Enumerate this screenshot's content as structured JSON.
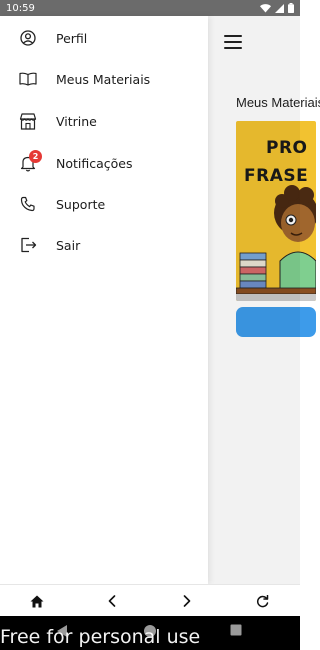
{
  "status_bar": {
    "time": "10:59",
    "icons": [
      "wifi-icon",
      "signal-icon",
      "battery-icon"
    ]
  },
  "background": {
    "section_title": "Meus Materiais",
    "card_line1": "PRO",
    "card_line2": "FRASE",
    "accent_color": "#3d9bea",
    "card_color": "#f2c230"
  },
  "drawer": {
    "items": [
      {
        "label": "Perfil",
        "icon": "user-circle-icon"
      },
      {
        "label": "Meus Materiais",
        "icon": "book-open-icon"
      },
      {
        "label": "Vitrine",
        "icon": "store-icon"
      },
      {
        "label": "Notificações",
        "icon": "bell-icon",
        "badge": "2"
      },
      {
        "label": "Suporte",
        "icon": "phone-icon"
      },
      {
        "label": "Sair",
        "icon": "logout-icon"
      }
    ]
  },
  "toolbar": {
    "buttons": [
      "home-icon",
      "back-chevron-icon",
      "forward-chevron-icon",
      "refresh-icon"
    ]
  },
  "system_nav": {
    "watermark": "Free for personal use",
    "buttons": [
      "back-triangle-icon",
      "home-circle-icon",
      "recents-square-icon"
    ]
  }
}
